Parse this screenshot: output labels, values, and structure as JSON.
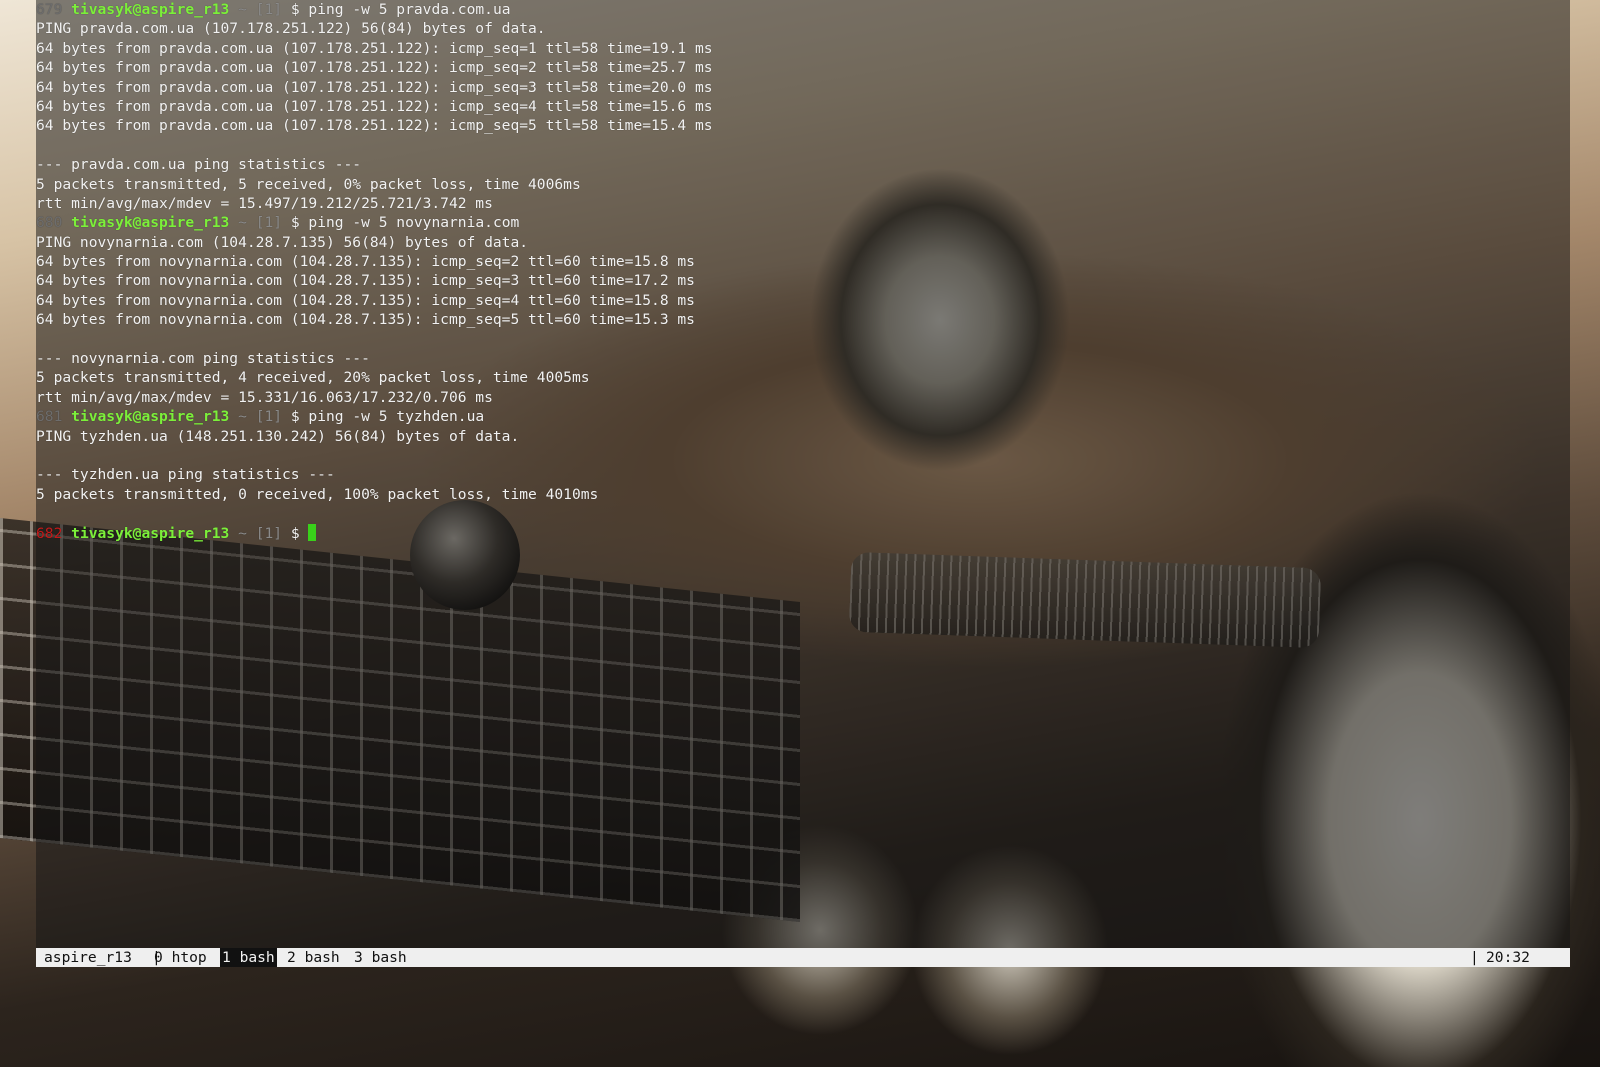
{
  "terminal": {
    "lines": [
      {
        "hist": "679",
        "user": "tivasyk@aspire_r13",
        "tilde": "~",
        "jobs": "[1]",
        "cmd": "$ ping -w 5 pravda.com.ua"
      },
      {
        "text": "PING pravda.com.ua (107.178.251.122) 56(84) bytes of data."
      },
      {
        "text": "64 bytes from pravda.com.ua (107.178.251.122): icmp_seq=1 ttl=58 time=19.1 ms"
      },
      {
        "text": "64 bytes from pravda.com.ua (107.178.251.122): icmp_seq=2 ttl=58 time=25.7 ms"
      },
      {
        "text": "64 bytes from pravda.com.ua (107.178.251.122): icmp_seq=3 ttl=58 time=20.0 ms"
      },
      {
        "text": "64 bytes from pravda.com.ua (107.178.251.122): icmp_seq=4 ttl=58 time=15.6 ms"
      },
      {
        "text": "64 bytes from pravda.com.ua (107.178.251.122): icmp_seq=5 ttl=58 time=15.4 ms"
      },
      {
        "text": ""
      },
      {
        "text": "--- pravda.com.ua ping statistics ---"
      },
      {
        "text": "5 packets transmitted, 5 received, 0% packet loss, time 4006ms"
      },
      {
        "text": "rtt min/avg/max/mdev = 15.497/19.212/25.721/3.742 ms"
      },
      {
        "hist": "680",
        "user": "tivasyk@aspire_r13",
        "tilde": "~",
        "jobs": "[1]",
        "cmd": "$ ping -w 5 novynarnia.com"
      },
      {
        "text": "PING novynarnia.com (104.28.7.135) 56(84) bytes of data."
      },
      {
        "text": "64 bytes from novynarnia.com (104.28.7.135): icmp_seq=2 ttl=60 time=15.8 ms"
      },
      {
        "text": "64 bytes from novynarnia.com (104.28.7.135): icmp_seq=3 ttl=60 time=17.2 ms"
      },
      {
        "text": "64 bytes from novynarnia.com (104.28.7.135): icmp_seq=4 ttl=60 time=15.8 ms"
      },
      {
        "text": "64 bytes from novynarnia.com (104.28.7.135): icmp_seq=5 ttl=60 time=15.3 ms"
      },
      {
        "text": ""
      },
      {
        "text": "--- novynarnia.com ping statistics ---"
      },
      {
        "text": "5 packets transmitted, 4 received, 20% packet loss, time 4005ms"
      },
      {
        "text": "rtt min/avg/max/mdev = 15.331/16.063/17.232/0.706 ms"
      },
      {
        "hist": "681",
        "user": "tivasyk@aspire_r13",
        "tilde": "~",
        "jobs": "[1]",
        "cmd": "$ ping -w 5 tyzhden.ua"
      },
      {
        "text": "PING tyzhden.ua (148.251.130.242) 56(84) bytes of data."
      },
      {
        "text": ""
      },
      {
        "text": "--- tyzhden.ua ping statistics ---"
      },
      {
        "text": "5 packets transmitted, 0 received, 100% packet loss, time 4010ms"
      },
      {
        "text": ""
      },
      {
        "hist": "682",
        "hist_error": true,
        "user": "tivasyk@aspire_r13",
        "tilde": "~",
        "jobs": "[1]",
        "cmd": "$ ",
        "cursor": true
      }
    ]
  },
  "statusbar": {
    "session": "aspire_r13",
    "separator": "|",
    "windows": [
      {
        "label": "0 htop",
        "active": false
      },
      {
        "label": "1 bash",
        "active": true
      },
      {
        "label": "2 bash",
        "active": false
      },
      {
        "label": "3 bash",
        "active": false
      }
    ],
    "clock": "20:32"
  },
  "colors": {
    "prompt_user": "#7cf03a",
    "history_number": "#6d6d6d",
    "history_number_error": "#c21a1a",
    "cursor": "#39d11a",
    "statusbar_bg": "#efefef",
    "statusbar_active_bg": "#111111"
  }
}
